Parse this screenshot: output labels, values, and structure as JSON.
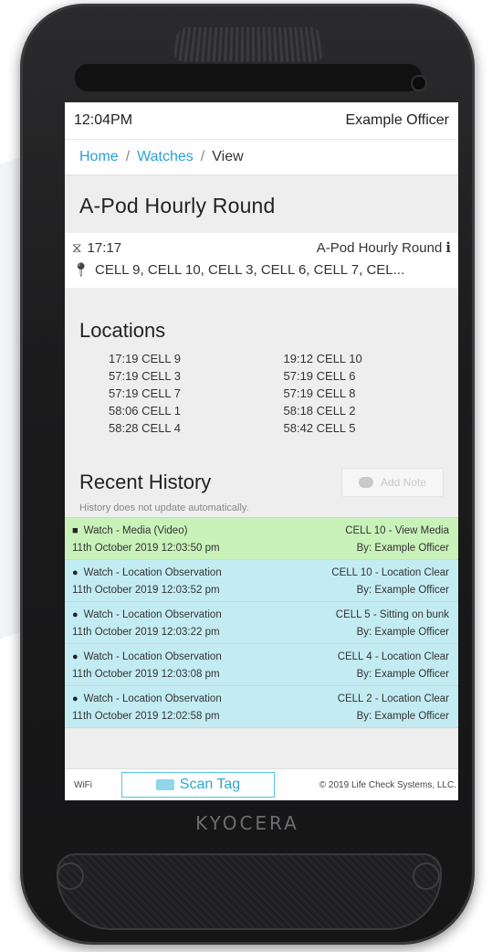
{
  "status_bar": {
    "time": "12:04PM",
    "user": "Example Officer"
  },
  "breadcrumb": {
    "home": "Home",
    "sep1": "/",
    "watches": "Watches",
    "sep2": "/",
    "current": "View"
  },
  "watch": {
    "title": "A-Pod Hourly Round",
    "duration": "17:17",
    "name": "A-Pod Hourly Round",
    "info_glyph": "i",
    "cells": "CELL 9, CELL 10, CELL 3, CELL 6, CELL 7, CEL..."
  },
  "locations": {
    "heading": "Locations",
    "items": [
      "17:19 CELL 9",
      "19:12 CELL 10",
      "57:19 CELL 3",
      "57:19 CELL 6",
      "57:19 CELL 7",
      "57:19 CELL 8",
      "58:06 CELL 1",
      "58:18 CELL 2",
      "58:28 CELL 4",
      "58:42 CELL 5"
    ]
  },
  "history": {
    "heading": "Recent History",
    "add_note_label": "Add Note",
    "note": "History does not update automatically.",
    "rows": [
      {
        "type": "media",
        "icon": "camera-icon",
        "title": "Watch - Media (Video)",
        "detail": "CELL 10 - View Media",
        "date": "11th October 2019 12:03:50 pm",
        "by": "By: Example Officer"
      },
      {
        "type": "obs",
        "icon": "eye-icon",
        "title": "Watch - Location Observation",
        "detail": "CELL 10 - Location Clear",
        "date": "11th October 2019 12:03:52 pm",
        "by": "By: Example Officer"
      },
      {
        "type": "obs",
        "icon": "eye-icon",
        "title": "Watch - Location Observation",
        "detail": "CELL 5 - Sitting on bunk",
        "date": "11th October 2019 12:03:22 pm",
        "by": "By: Example Officer"
      },
      {
        "type": "obs",
        "icon": "eye-icon",
        "title": "Watch - Location Observation",
        "detail": "CELL 4 - Location Clear",
        "date": "11th October 2019 12:03:08 pm",
        "by": "By: Example Officer"
      },
      {
        "type": "obs",
        "icon": "eye-icon",
        "title": "Watch - Location Observation",
        "detail": "CELL 2 - Location Clear",
        "date": "11th October 2019 12:02:58 pm",
        "by": "By: Example Officer"
      }
    ]
  },
  "footer": {
    "wifi": "WiFi",
    "scan_label": "Scan Tag",
    "copyright": "© 2019 Life Check Systems, LLC."
  },
  "device": {
    "brand": "KYOCERA"
  },
  "colors": {
    "link": "#2a9fd6",
    "media_row": "#c9f2ba",
    "observation_row": "#c3ecf2",
    "scan_button": "#29a8cf"
  }
}
